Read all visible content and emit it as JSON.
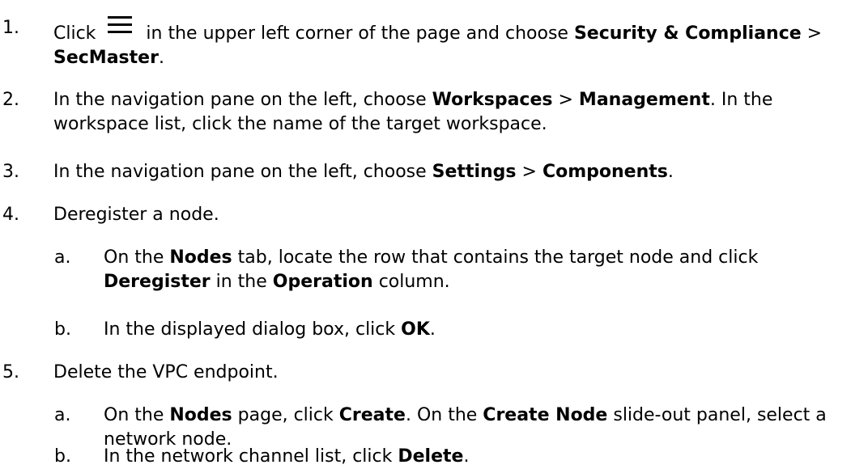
{
  "steps": [
    {
      "num": "1.",
      "t1": "Click",
      "t2": "in the upper left corner of the page and choose",
      "b1": "Security & Compliance",
      "t3": ">",
      "b2": "SecMaster",
      "t4": "."
    },
    {
      "num": "2.",
      "t1": "In the navigation pane on the left, choose",
      "b1": "Workspaces",
      "t2": ">",
      "b2": "Management",
      "t3": ". In the workspace list, click the name of the target workspace."
    },
    {
      "num": "3.",
      "t1": "In the navigation pane on the left, choose",
      "b1": "Settings",
      "t2": ">",
      "b2": "Components",
      "t3": "."
    },
    {
      "num": "4.",
      "t1": "Deregister a node.",
      "substeps": [
        {
          "num": "a.",
          "t1": "On the",
          "b1": "Nodes",
          "t2": "tab, locate the row that contains the target node and click",
          "b2": "Deregister",
          "t3": "in the",
          "b3": "Operation",
          "t4": "column."
        },
        {
          "num": "b.",
          "t1": "In the displayed dialog box, click",
          "b1": "OK",
          "t2": "."
        }
      ]
    },
    {
      "num": "5.",
      "t1": "Delete the VPC endpoint.",
      "substeps": [
        {
          "num": "a.",
          "t1": "On the",
          "b1": "Nodes",
          "t2": "page, click",
          "b2": "Create",
          "t3": ". On the",
          "b3": "Create Node",
          "t4": "slide-out panel, select a network node."
        },
        {
          "num": "b.",
          "t1": "In the network channel list, click",
          "b1": "Delete",
          "t2": "."
        }
      ]
    }
  ]
}
